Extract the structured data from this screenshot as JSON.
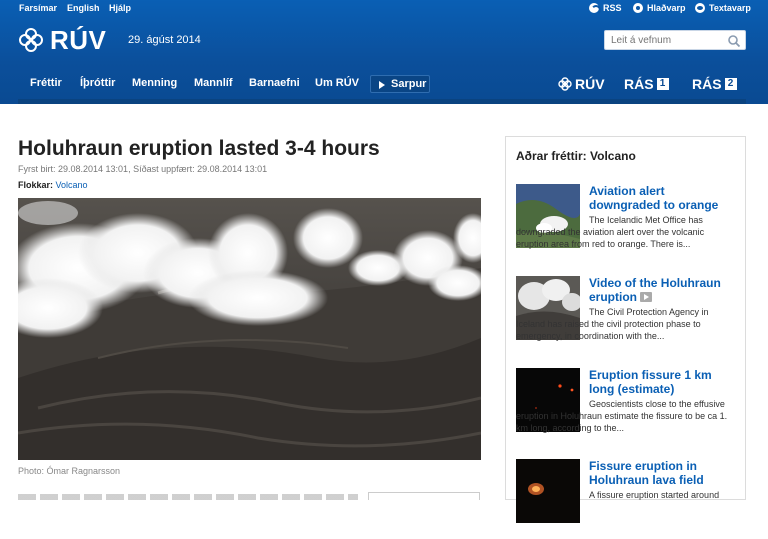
{
  "topbar": {
    "left_links": [
      "Farsímar",
      "English",
      "Hjálp"
    ],
    "right_links": [
      "RSS",
      "Hlaðvarp",
      "Textavarp"
    ]
  },
  "header": {
    "logo": "RÚV",
    "date": "29. ágúst 2014",
    "search_placeholder": "Leit á vefnum"
  },
  "nav": {
    "items": [
      "Fréttir",
      "Íþróttir",
      "Menning",
      "Mannlíf",
      "Barnaefni",
      "Um RÚV"
    ],
    "sarpur": "Sarpur",
    "brands": {
      "ruv": "RÚV",
      "ras": "RÁS",
      "ras1": "1",
      "ras2": "2"
    }
  },
  "article": {
    "title": "Holuhraun eruption lasted 3-4 hours",
    "meta": "Fyrst birt: 29.08.2014 13:01, Síðast uppfært: 29.08.2014 13:01",
    "categories_label": "Flokkar:",
    "category": "Volcano",
    "photo_caption": "Photo: Ómar Ragnarsson"
  },
  "sidebar": {
    "heading": "Aðrar fréttir: Volcano",
    "items": [
      {
        "title": "Aviation alert downgraded to orange",
        "text": "The Icelandic Met Office has downgraded the aviation alert over the volcanic eruption area from red to orange. There is..."
      },
      {
        "title": "Video of the Holuhraun eruption",
        "text": "The Civil Protection Agency in Iceland has raised the civil protection phase to emergency, in coordination with the..."
      },
      {
        "title": "Eruption fissure 1 km long (estimate)",
        "text": "Geoscientists close to the effusive eruption in Holuhraun estimate the fissure to be ca 1. km long, according to the..."
      },
      {
        "title": "Fissure eruption in Holuhraun lava field",
        "text": "A fissure eruption started around"
      }
    ]
  },
  "colors": {
    "header_blue": "#0b4f9b",
    "link_blue": "#0a5fb4"
  }
}
